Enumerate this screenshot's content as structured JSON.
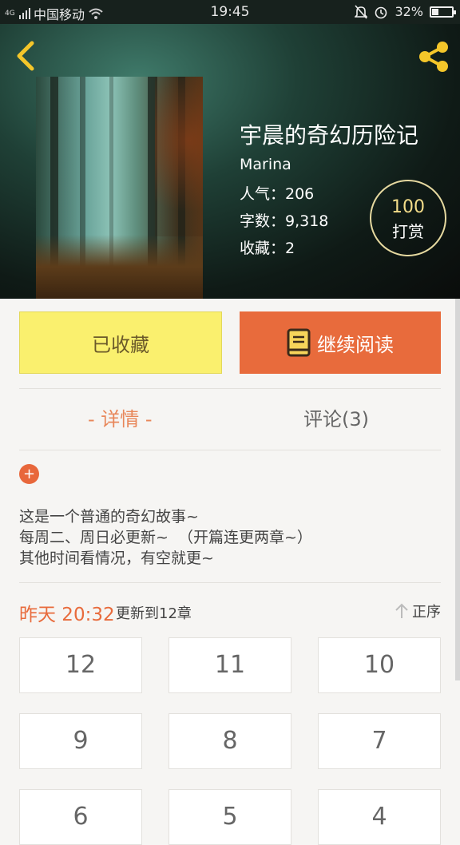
{
  "status_bar": {
    "network_small": "4G",
    "carrier": "中国移动",
    "time": "19:45",
    "battery": "32%",
    "battery_level": 0.32
  },
  "book": {
    "title": "宇晨的奇幻历险记",
    "author": "Marina",
    "popularity": "人气：206",
    "word_count": "字数：9,318",
    "favorites": "收藏：2"
  },
  "tip": {
    "amount": "100",
    "label": "打赏"
  },
  "actions": {
    "favorite_label": "已收藏",
    "continue_label": "继续阅读"
  },
  "tabs": [
    {
      "label": "- 详情 -"
    },
    {
      "label": "评论(3)"
    }
  ],
  "description": {
    "lines": [
      "这是一个普通的奇幻故事~",
      "每周二、周日必更新~  （开篇连更两章~）",
      "其他时间看情况，有空就更~"
    ]
  },
  "update": {
    "time": "昨天 20:32",
    "text": "更新到12章",
    "sort_label": "正序"
  },
  "chapters": [
    "12",
    "11",
    "10",
    "9",
    "8",
    "7",
    "6",
    "5",
    "4"
  ],
  "colors": {
    "accent": "#e86b3c",
    "favorite_bg": "#faf06e",
    "tab_active": "#e8875a",
    "tip_border": "#e6d9a0"
  }
}
